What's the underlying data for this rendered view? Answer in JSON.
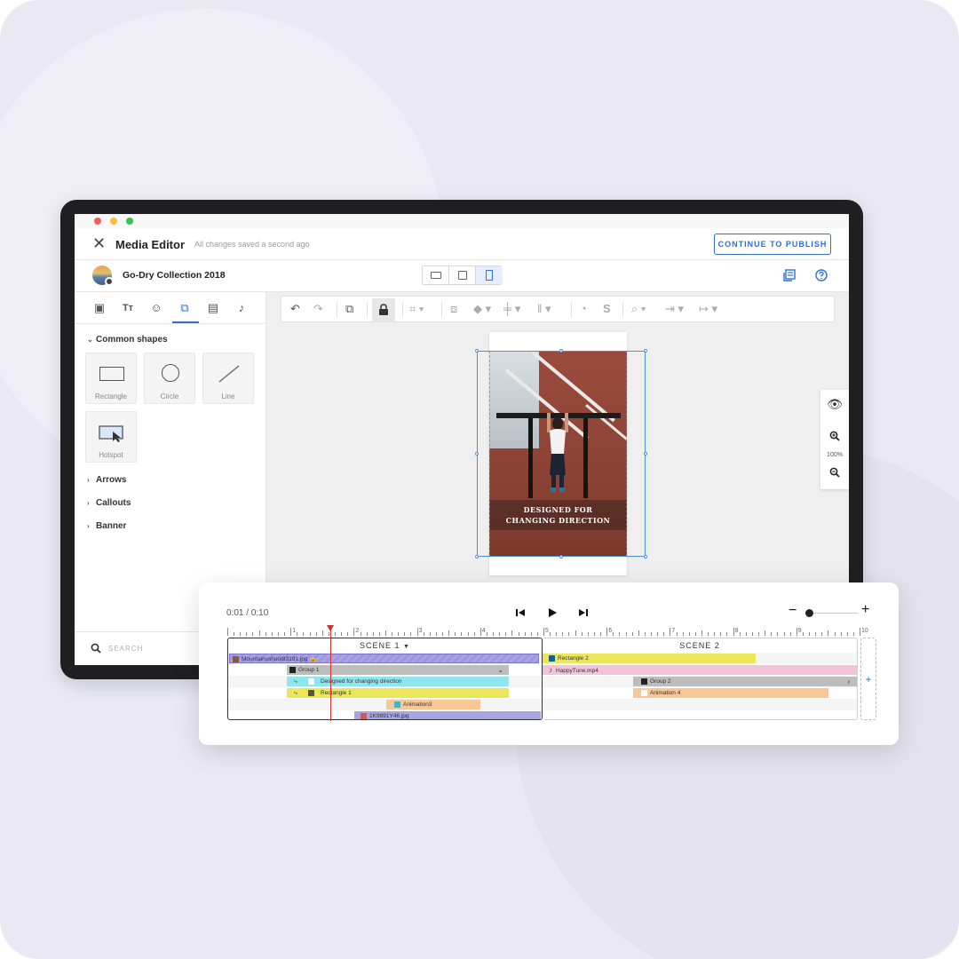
{
  "app": {
    "title": "Media Editor",
    "save_status": "All changes saved a second ago",
    "publish_label": "CONTINUE TO PUBLISH"
  },
  "project": {
    "name": "Go-Dry Collection 2018",
    "format_options": [
      "landscape",
      "square",
      "portrait"
    ],
    "selected_format": "portrait"
  },
  "side_panel": {
    "tab_icons": [
      "image-icon",
      "text-icon",
      "emoji-icon",
      "shapes-icon",
      "media-icon",
      "music-icon"
    ],
    "active_tab": "shapes-icon",
    "section_common": "Common shapes",
    "shapes": [
      "Rectangle",
      "Circle",
      "Line",
      "Hotspot"
    ],
    "sections": [
      "Arrows",
      "Callouts",
      "Banner"
    ],
    "search_placeholder": "SEARCH"
  },
  "canvas": {
    "caption_line1": "DESIGNED FOR",
    "caption_line2": "CHANGING DIRECTION",
    "zoom_level": "100%"
  },
  "timeline": {
    "time": "0:01 / 0:10",
    "ruler_numbers": [
      "1",
      "2",
      "3",
      "4",
      "5",
      "6",
      "7",
      "8",
      "9",
      "10"
    ],
    "scene1_title": "SCENE 1",
    "scene2_title": "SCENE 2",
    "scene1_clips": {
      "image_clip": "Mountainsshoot83191.jpg",
      "group1": "Group 1",
      "text_clip": "Designed for changing direction",
      "rect1": "Rectangle 1",
      "anim3": "Animation3",
      "image2": "1K9891Y46.jpg"
    },
    "scene2_clips": {
      "rect2": "Rectangle 2",
      "audio": "HappyTune.mp4",
      "group2": "Group 2",
      "anim4": "Animation 4"
    },
    "add_scene_label": "+"
  },
  "colors": {
    "accent": "#2d6fd6",
    "clip_purple": "#a9a4e4",
    "clip_cyan": "#8fe6ee",
    "clip_yellow": "#ece65a",
    "clip_orange": "#f8c795",
    "clip_pink": "#f1c4dc",
    "clip_gray": "#bdbdbd",
    "playhead": "#d32f2f"
  }
}
